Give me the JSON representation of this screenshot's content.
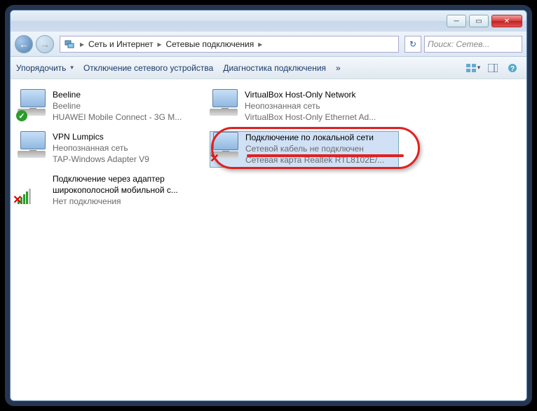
{
  "breadcrumb": {
    "seg1": "Сеть и Интернет",
    "seg2": "Сетевые подключения"
  },
  "search": {
    "placeholder": "Поиск: Сетев..."
  },
  "toolbar": {
    "organize": "Упорядочить",
    "disable": "Отключение сетевого устройства",
    "diagnose": "Диагностика подключения",
    "more": "»"
  },
  "connections": [
    {
      "name": "Beeline",
      "status": "Beeline",
      "device": "HUAWEI Mobile Connect - 3G M...",
      "icon": "ok"
    },
    {
      "name": "VirtualBox Host-Only Network",
      "status": "Неопознанная сеть",
      "device": "VirtualBox Host-Only Ethernet Ad...",
      "icon": "plain"
    },
    {
      "name": "VPN Lumpics",
      "status": "Неопознанная сеть",
      "device": "TAP-Windows Adapter V9",
      "icon": "plain"
    },
    {
      "name": "Подключение по локальной сети",
      "status": "Сетевой кабель не подключен",
      "device": "Сетевая карта Realtek RTL8102E/...",
      "icon": "x"
    },
    {
      "name": "Подключение через адаптер широкополосной мобильной с...",
      "status": "Нет подключения",
      "device": "",
      "icon": "bars"
    }
  ]
}
